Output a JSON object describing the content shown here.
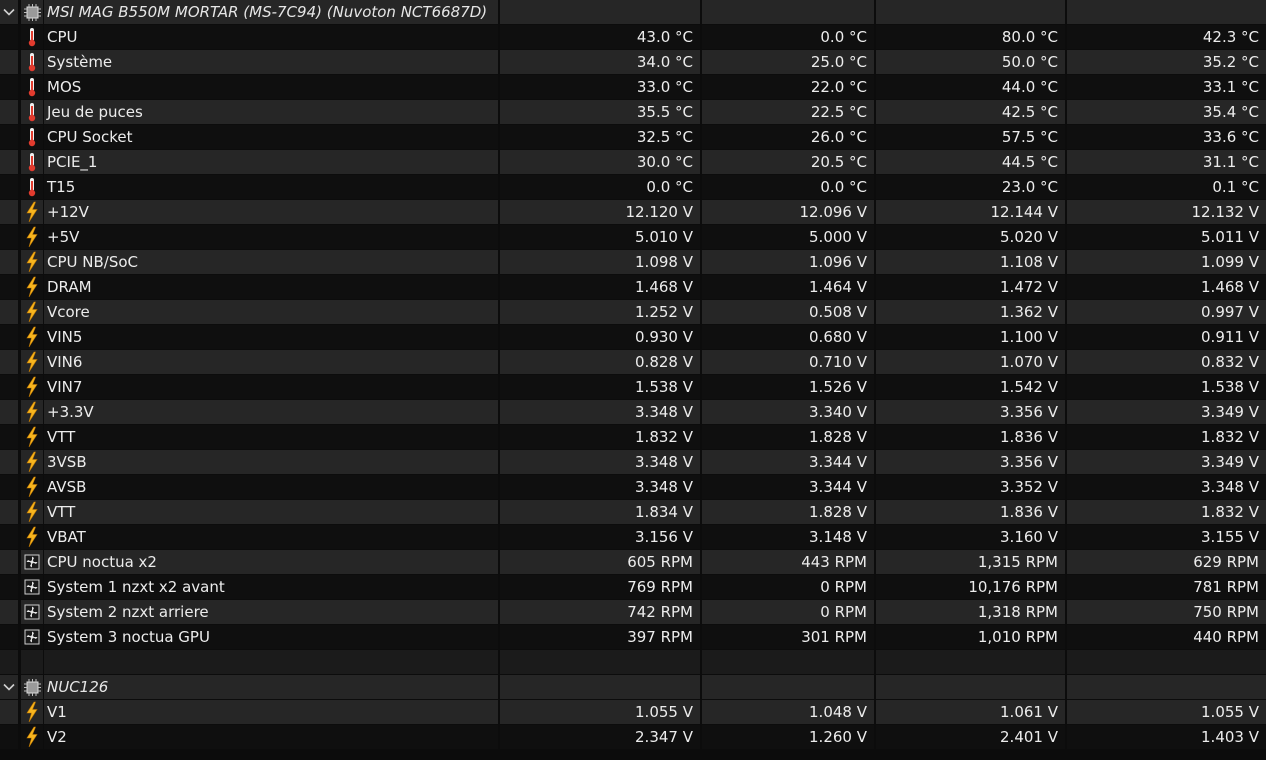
{
  "groups": [
    {
      "name": "MSI MAG B550M MORTAR (MS-7C94) (Nuvoton NCT6687D)",
      "icon": "chip-icon",
      "rows": [
        {
          "label": "CPU",
          "icon": "thermometer-icon",
          "v": [
            "43.0 °C",
            "0.0 °C",
            "80.0 °C",
            "42.3 °C"
          ]
        },
        {
          "label": "Système",
          "icon": "thermometer-icon",
          "v": [
            "34.0 °C",
            "25.0 °C",
            "50.0 °C",
            "35.2 °C"
          ]
        },
        {
          "label": "MOS",
          "icon": "thermometer-icon",
          "v": [
            "33.0 °C",
            "22.0 °C",
            "44.0 °C",
            "33.1 °C"
          ]
        },
        {
          "label": "Jeu de puces",
          "icon": "thermometer-icon",
          "v": [
            "35.5 °C",
            "22.5 °C",
            "42.5 °C",
            "35.4 °C"
          ]
        },
        {
          "label": "CPU Socket",
          "icon": "thermometer-icon",
          "v": [
            "32.5 °C",
            "26.0 °C",
            "57.5 °C",
            "33.6 °C"
          ]
        },
        {
          "label": "PCIE_1",
          "icon": "thermometer-icon",
          "v": [
            "30.0 °C",
            "20.5 °C",
            "44.5 °C",
            "31.1 °C"
          ]
        },
        {
          "label": "T15",
          "icon": "thermometer-icon",
          "v": [
            "0.0 °C",
            "0.0 °C",
            "23.0 °C",
            "0.1 °C"
          ]
        },
        {
          "label": "+12V",
          "icon": "lightning-icon",
          "v": [
            "12.120 V",
            "12.096 V",
            "12.144 V",
            "12.132 V"
          ]
        },
        {
          "label": "+5V",
          "icon": "lightning-icon",
          "v": [
            "5.010 V",
            "5.000 V",
            "5.020 V",
            "5.011 V"
          ]
        },
        {
          "label": "CPU NB/SoC",
          "icon": "lightning-icon",
          "v": [
            "1.098 V",
            "1.096 V",
            "1.108 V",
            "1.099 V"
          ]
        },
        {
          "label": "DRAM",
          "icon": "lightning-icon",
          "v": [
            "1.468 V",
            "1.464 V",
            "1.472 V",
            "1.468 V"
          ]
        },
        {
          "label": "Vcore",
          "icon": "lightning-icon",
          "v": [
            "1.252 V",
            "0.508 V",
            "1.362 V",
            "0.997 V"
          ]
        },
        {
          "label": "VIN5",
          "icon": "lightning-icon",
          "v": [
            "0.930 V",
            "0.680 V",
            "1.100 V",
            "0.911 V"
          ]
        },
        {
          "label": "VIN6",
          "icon": "lightning-icon",
          "v": [
            "0.828 V",
            "0.710 V",
            "1.070 V",
            "0.832 V"
          ]
        },
        {
          "label": "VIN7",
          "icon": "lightning-icon",
          "v": [
            "1.538 V",
            "1.526 V",
            "1.542 V",
            "1.538 V"
          ]
        },
        {
          "label": "+3.3V",
          "icon": "lightning-icon",
          "v": [
            "3.348 V",
            "3.340 V",
            "3.356 V",
            "3.349 V"
          ]
        },
        {
          "label": "VTT",
          "icon": "lightning-icon",
          "v": [
            "1.832 V",
            "1.828 V",
            "1.836 V",
            "1.832 V"
          ]
        },
        {
          "label": "3VSB",
          "icon": "lightning-icon",
          "v": [
            "3.348 V",
            "3.344 V",
            "3.356 V",
            "3.349 V"
          ]
        },
        {
          "label": "AVSB",
          "icon": "lightning-icon",
          "v": [
            "3.348 V",
            "3.344 V",
            "3.352 V",
            "3.348 V"
          ]
        },
        {
          "label": "VTT",
          "icon": "lightning-icon",
          "v": [
            "1.834 V",
            "1.828 V",
            "1.836 V",
            "1.832 V"
          ]
        },
        {
          "label": "VBAT",
          "icon": "lightning-icon",
          "v": [
            "3.156 V",
            "3.148 V",
            "3.160 V",
            "3.155 V"
          ]
        },
        {
          "label": "CPU noctua x2",
          "icon": "fan-icon",
          "v": [
            "605 RPM",
            "443 RPM",
            "1,315 RPM",
            "629 RPM"
          ]
        },
        {
          "label": "System 1 nzxt x2 avant",
          "icon": "fan-icon",
          "v": [
            "769 RPM",
            "0 RPM",
            "10,176 RPM",
            "781 RPM"
          ]
        },
        {
          "label": "System 2 nzxt arriere",
          "icon": "fan-icon",
          "v": [
            "742 RPM",
            "0 RPM",
            "1,318 RPM",
            "750 RPM"
          ]
        },
        {
          "label": "System 3 noctua GPU",
          "icon": "fan-icon",
          "v": [
            "397 RPM",
            "301 RPM",
            "1,010 RPM",
            "440 RPM"
          ]
        }
      ]
    },
    {
      "name": "NUC126",
      "icon": "chip-icon",
      "rows": [
        {
          "label": "V1",
          "icon": "lightning-icon",
          "v": [
            "1.055 V",
            "1.048 V",
            "1.061 V",
            "1.055 V"
          ]
        },
        {
          "label": "V2",
          "icon": "lightning-icon",
          "v": [
            "2.347 V",
            "1.260 V",
            "2.401 V",
            "1.403 V"
          ]
        }
      ]
    }
  ],
  "colors": {
    "row_odd": "#262626",
    "row_even": "#0f0f0f",
    "thermometer": "#e23b2e",
    "lightning": "#f7b51f",
    "text": "#ececec"
  }
}
